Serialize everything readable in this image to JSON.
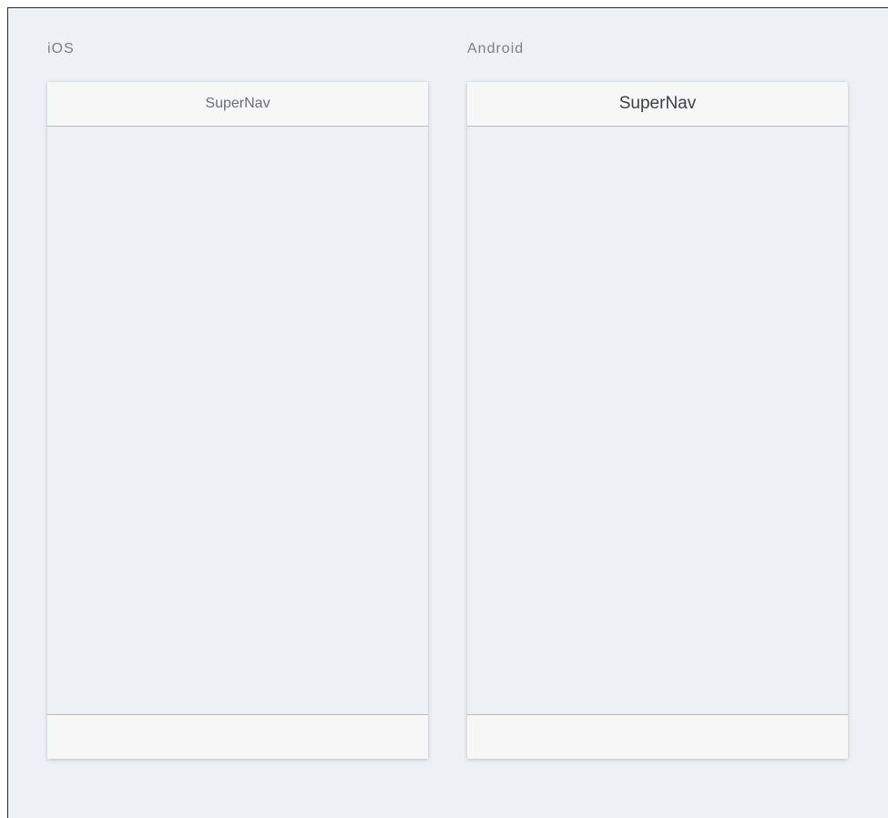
{
  "platforms": {
    "ios": {
      "label": "iOS",
      "nav_title": "SuperNav"
    },
    "android": {
      "label": "Android",
      "nav_title": "SuperNav"
    }
  },
  "colors": {
    "background": "#edf1f5",
    "bar_background": "#f7f7f7",
    "divider": "#b9bdc2",
    "label_text": "#7a7f86"
  }
}
